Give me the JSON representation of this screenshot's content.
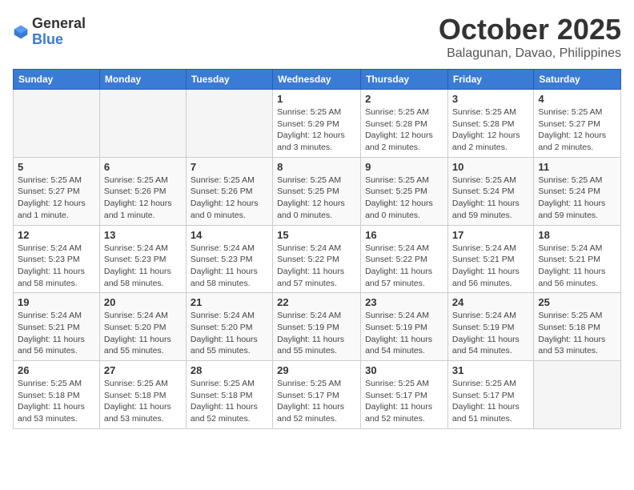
{
  "header": {
    "logo_general": "General",
    "logo_blue": "Blue",
    "month_title": "October 2025",
    "location": "Balagunan, Davao, Philippines"
  },
  "weekdays": [
    "Sunday",
    "Monday",
    "Tuesday",
    "Wednesday",
    "Thursday",
    "Friday",
    "Saturday"
  ],
  "weeks": [
    [
      {
        "day": "",
        "info": ""
      },
      {
        "day": "",
        "info": ""
      },
      {
        "day": "",
        "info": ""
      },
      {
        "day": "1",
        "info": "Sunrise: 5:25 AM\nSunset: 5:29 PM\nDaylight: 12 hours and 3 minutes."
      },
      {
        "day": "2",
        "info": "Sunrise: 5:25 AM\nSunset: 5:28 PM\nDaylight: 12 hours and 2 minutes."
      },
      {
        "day": "3",
        "info": "Sunrise: 5:25 AM\nSunset: 5:28 PM\nDaylight: 12 hours and 2 minutes."
      },
      {
        "day": "4",
        "info": "Sunrise: 5:25 AM\nSunset: 5:27 PM\nDaylight: 12 hours and 2 minutes."
      }
    ],
    [
      {
        "day": "5",
        "info": "Sunrise: 5:25 AM\nSunset: 5:27 PM\nDaylight: 12 hours and 1 minute."
      },
      {
        "day": "6",
        "info": "Sunrise: 5:25 AM\nSunset: 5:26 PM\nDaylight: 12 hours and 1 minute."
      },
      {
        "day": "7",
        "info": "Sunrise: 5:25 AM\nSunset: 5:26 PM\nDaylight: 12 hours and 0 minutes."
      },
      {
        "day": "8",
        "info": "Sunrise: 5:25 AM\nSunset: 5:25 PM\nDaylight: 12 hours and 0 minutes."
      },
      {
        "day": "9",
        "info": "Sunrise: 5:25 AM\nSunset: 5:25 PM\nDaylight: 12 hours and 0 minutes."
      },
      {
        "day": "10",
        "info": "Sunrise: 5:25 AM\nSunset: 5:24 PM\nDaylight: 11 hours and 59 minutes."
      },
      {
        "day": "11",
        "info": "Sunrise: 5:25 AM\nSunset: 5:24 PM\nDaylight: 11 hours and 59 minutes."
      }
    ],
    [
      {
        "day": "12",
        "info": "Sunrise: 5:24 AM\nSunset: 5:23 PM\nDaylight: 11 hours and 58 minutes."
      },
      {
        "day": "13",
        "info": "Sunrise: 5:24 AM\nSunset: 5:23 PM\nDaylight: 11 hours and 58 minutes."
      },
      {
        "day": "14",
        "info": "Sunrise: 5:24 AM\nSunset: 5:23 PM\nDaylight: 11 hours and 58 minutes."
      },
      {
        "day": "15",
        "info": "Sunrise: 5:24 AM\nSunset: 5:22 PM\nDaylight: 11 hours and 57 minutes."
      },
      {
        "day": "16",
        "info": "Sunrise: 5:24 AM\nSunset: 5:22 PM\nDaylight: 11 hours and 57 minutes."
      },
      {
        "day": "17",
        "info": "Sunrise: 5:24 AM\nSunset: 5:21 PM\nDaylight: 11 hours and 56 minutes."
      },
      {
        "day": "18",
        "info": "Sunrise: 5:24 AM\nSunset: 5:21 PM\nDaylight: 11 hours and 56 minutes."
      }
    ],
    [
      {
        "day": "19",
        "info": "Sunrise: 5:24 AM\nSunset: 5:21 PM\nDaylight: 11 hours and 56 minutes."
      },
      {
        "day": "20",
        "info": "Sunrise: 5:24 AM\nSunset: 5:20 PM\nDaylight: 11 hours and 55 minutes."
      },
      {
        "day": "21",
        "info": "Sunrise: 5:24 AM\nSunset: 5:20 PM\nDaylight: 11 hours and 55 minutes."
      },
      {
        "day": "22",
        "info": "Sunrise: 5:24 AM\nSunset: 5:19 PM\nDaylight: 11 hours and 55 minutes."
      },
      {
        "day": "23",
        "info": "Sunrise: 5:24 AM\nSunset: 5:19 PM\nDaylight: 11 hours and 54 minutes."
      },
      {
        "day": "24",
        "info": "Sunrise: 5:24 AM\nSunset: 5:19 PM\nDaylight: 11 hours and 54 minutes."
      },
      {
        "day": "25",
        "info": "Sunrise: 5:25 AM\nSunset: 5:18 PM\nDaylight: 11 hours and 53 minutes."
      }
    ],
    [
      {
        "day": "26",
        "info": "Sunrise: 5:25 AM\nSunset: 5:18 PM\nDaylight: 11 hours and 53 minutes."
      },
      {
        "day": "27",
        "info": "Sunrise: 5:25 AM\nSunset: 5:18 PM\nDaylight: 11 hours and 53 minutes."
      },
      {
        "day": "28",
        "info": "Sunrise: 5:25 AM\nSunset: 5:18 PM\nDaylight: 11 hours and 52 minutes."
      },
      {
        "day": "29",
        "info": "Sunrise: 5:25 AM\nSunset: 5:17 PM\nDaylight: 11 hours and 52 minutes."
      },
      {
        "day": "30",
        "info": "Sunrise: 5:25 AM\nSunset: 5:17 PM\nDaylight: 11 hours and 52 minutes."
      },
      {
        "day": "31",
        "info": "Sunrise: 5:25 AM\nSunset: 5:17 PM\nDaylight: 11 hours and 51 minutes."
      },
      {
        "day": "",
        "info": ""
      }
    ]
  ]
}
